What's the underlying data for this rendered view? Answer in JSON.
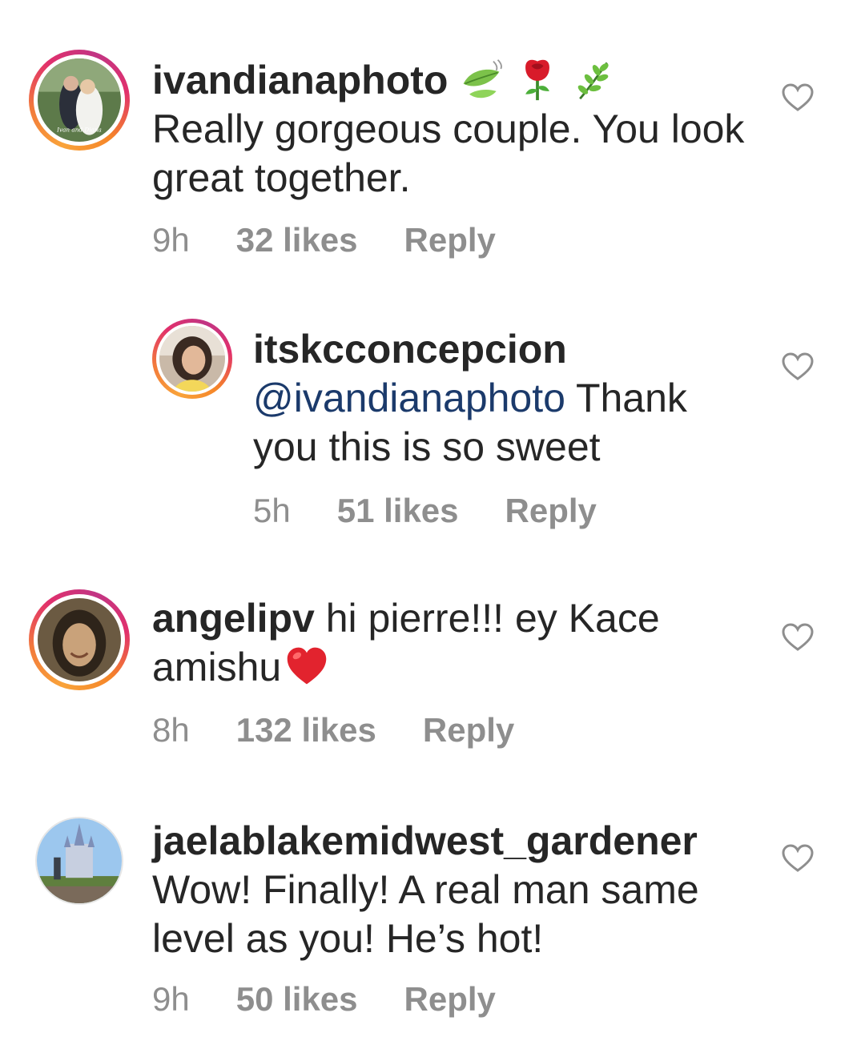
{
  "comments": [
    {
      "username": "ivandianaphoto",
      "avatar_caption": "Ivan and Diana",
      "emojis": [
        "leaf-fluttering-in-wind",
        "rose",
        "herb"
      ],
      "text": "Really gorgeous couple. You look great together.",
      "time": "9h",
      "likes": "32 likes",
      "reply": "Reply"
    },
    {
      "username": "itskcconcepcion",
      "mention": "@ivandianaphoto",
      "text": "Thank you this is so sweet",
      "time": "5h",
      "likes": "51 likes",
      "reply": "Reply"
    },
    {
      "username": "angelipv",
      "text": "hi pierre!!! ey Kace amishu",
      "emojis": [
        "red-heart"
      ],
      "time": "8h",
      "likes": "132 likes",
      "reply": "Reply"
    },
    {
      "username": "jaelablakemidwest_gardener",
      "text": "Wow! Finally!  A real man same level as you! He’s hot!",
      "time": "9h",
      "likes": "50 likes",
      "reply": "Reply"
    }
  ],
  "colors": {
    "text": "#262626",
    "meta": "#8e8e8e",
    "mention": "#1b3a6b",
    "heart_outline": "#8e8e8e"
  }
}
